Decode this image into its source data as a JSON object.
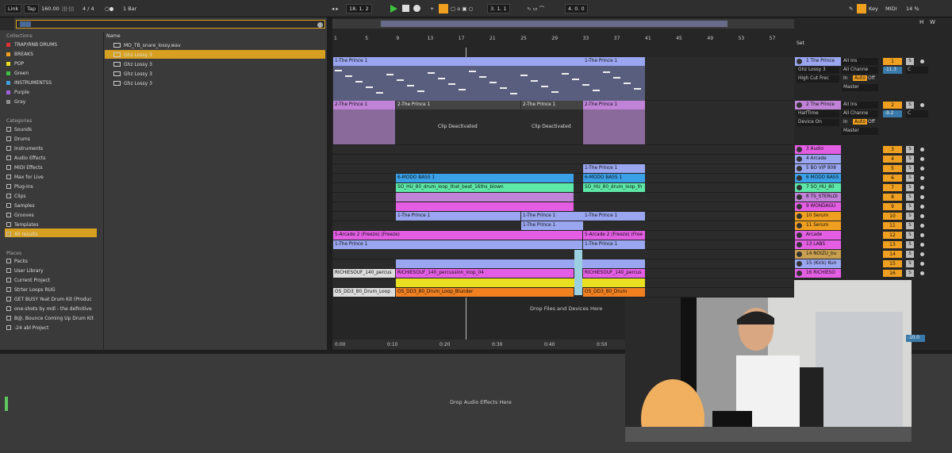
{
  "transport": {
    "link": "Link",
    "tap": "Tap",
    "tempo": "160.00",
    "meter": "4 / 4",
    "quantize": "1 Bar",
    "position": "18.  1.  2",
    "loop_start": "3.  1.  1",
    "loop_length": "4.  0.  0",
    "key": "Key",
    "midi": "MIDI",
    "cpu": "14 %"
  },
  "colors": {
    "accent": "#d8a020",
    "play": "#3fc43f"
  },
  "browser": {
    "collections_head": "Collections",
    "collections": [
      {
        "label": "TRAP/RNB DRUMS",
        "color": "#e03030"
      },
      {
        "label": "BREAKS",
        "color": "#f0a020"
      },
      {
        "label": "POP",
        "color": "#e8e020"
      },
      {
        "label": "Green",
        "color": "#40c040"
      },
      {
        "label": "INSTRUMENTSS",
        "color": "#40a0e0"
      },
      {
        "label": "Purple",
        "color": "#a060e0"
      },
      {
        "label": "Gray",
        "color": "#909090"
      }
    ],
    "categories_head": "Categories",
    "categories": [
      "Sounds",
      "Drums",
      "Instruments",
      "Audio Effects",
      "MIDI Effects",
      "Max for Live",
      "Plug-Ins",
      "Clips",
      "Samples",
      "Grooves",
      "Templates",
      "All results"
    ],
    "places_head": "Places",
    "places": [
      "Packs",
      "User Library",
      "Current Project",
      "Strter Loops RUG",
      "GET BUSY Yeat Drum Kit (Produc",
      "one-shots by mdl - the definitive",
      "B@, Bounce Coming Up Drum Kit",
      "-24 abl Project"
    ],
    "name_head": "Name",
    "files": [
      "MO_TB_snare_lossy.wav",
      "Ghz Lossy 3",
      "Ghz Lossy 3",
      "Ghz Lossy 3",
      "Ghz Lossy 3"
    ]
  },
  "ruler": [
    "1",
    "5",
    "9",
    "13",
    "17",
    "21",
    "25",
    "29",
    "33",
    "37",
    "41",
    "45",
    "49",
    "53",
    "57"
  ],
  "timeline": [
    "0:00",
    "0:10",
    "0:20",
    "0:30",
    "0:40",
    "0:50"
  ],
  "clips": {
    "t1a": "1-The Prince 1",
    "t1b": "1-The Prince 1",
    "t2a": "2-The Prince 1",
    "t2b": "2-The Prince 1",
    "t2c": "2-The Prince 1",
    "t2d": "2-The Prince 1",
    "deact1": "Clip Deactivated",
    "deact2": "Clip Deactivated",
    "p1": "1-The Prince 1",
    "modo1": "6-MODO BASS 1",
    "modo2": "6-MODO BASS 1",
    "so1": "SO_HU_80_drum_loop_that_beat_16ths_blown",
    "so2": "SO_HU_80_drum_loop_th",
    "p2": "1-The Prince 1",
    "p3": "1-The Prince 1",
    "p4": "1-The Prince 1",
    "p5": "1-The Prince 1",
    "arc1": "5-Arcade 2 (Freeze) (Freeze)",
    "arc2": "5-Arcade 2 (Freeze) (Free",
    "p6": "1-The Prince 1",
    "p7": "1-The Prince 1",
    "rich1": "RICHIESOUF_140_percus",
    "rich2": "RICHIESOUF_140_percussion_loop_04",
    "rich3": "RICHIESOUF_140_percus",
    "os1": "OS_DD3_80_Drum_Loop",
    "os2": "OS_DD3_80_Drum_Loop_Blunder",
    "os3": "OS_DD3_80_Drum",
    "drop": "Drop Files and Devices Here"
  },
  "mixer": {
    "set": "Set",
    "io": {
      "allins": "All Ins",
      "allch": "All Channe",
      "in": "In",
      "auto": "Auto",
      "off": "Off",
      "master": "Master",
      "vol1": "-11.3",
      "vol2": "-9.2",
      "c": "C"
    },
    "devices1": [
      "Ghz Lossy 3",
      "High Cut Frec"
    ],
    "devices2": [
      "HalfTime",
      "Device On"
    ],
    "tracks": [
      {
        "name": "1 The Prince",
        "num": "1",
        "color": "#9aa6f0"
      },
      {
        "name": "2 The Prince",
        "num": "2",
        "color": "#c083d8"
      },
      {
        "name": "3 Audio",
        "num": "3",
        "color": "#e45ee4"
      },
      {
        "name": "4 Arcade",
        "num": "4",
        "color": "#9aa6f0"
      },
      {
        "name": "5 BO VIP 808",
        "num": "5",
        "color": "#9aa6f0"
      },
      {
        "name": "6 MODO BASS",
        "num": "6",
        "color": "#3aa0e8"
      },
      {
        "name": "7 SO_HU_80",
        "num": "7",
        "color": "#5ee8a8"
      },
      {
        "name": "8 TS_STERLOI",
        "num": "8",
        "color": "#c083d8"
      },
      {
        "name": "9 WONDAGU",
        "num": "9",
        "color": "#e45ee4"
      },
      {
        "name": "10 Serum",
        "num": "10",
        "color": "#f0a020"
      },
      {
        "name": "11 Serum",
        "num": "11",
        "color": "#f0a020"
      },
      {
        "name": "Arcade",
        "num": "12",
        "color": "#e45ee4"
      },
      {
        "name": "13 LABS",
        "num": "13",
        "color": "#e45ee4"
      },
      {
        "name": "14 NOIZU_bu",
        "num": "14",
        "color": "#c8a050"
      },
      {
        "name": "15 (Kick) Kun",
        "num": "15",
        "color": "#9aa6f0"
      },
      {
        "name": "16 RICHIESO",
        "num": "16",
        "color": "#e45ee4"
      }
    ],
    "master_vol": "-10.0"
  },
  "bottom": {
    "drop_fx": "Drop Audio Effects Here"
  },
  "sticker": {
    "label": "H",
    "label2": "W"
  }
}
